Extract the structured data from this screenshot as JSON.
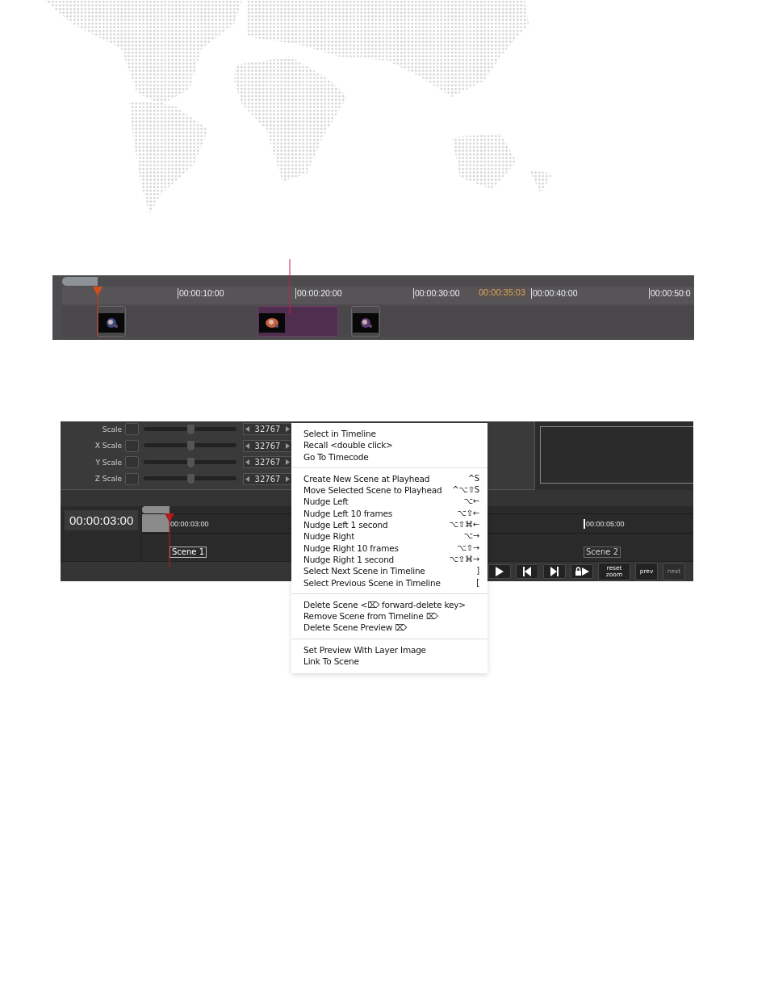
{
  "top_timeline": {
    "ticks": [
      "00:00:10:00",
      "00:00:20:00",
      "00:00:30:00",
      "00:00:40:00",
      "00:00:50:0"
    ],
    "playhead_time": "00:00:35:03",
    "clips": [
      {
        "kind": "picture",
        "selected": false
      },
      {
        "kind": "picture",
        "selected": true
      },
      {
        "kind": "picture",
        "selected": false
      }
    ]
  },
  "inspector": {
    "rows": [
      {
        "label": "Scale",
        "checked": false,
        "value": "32767",
        "level": 0.5
      },
      {
        "label": "X Scale",
        "checked": false,
        "value": "32767",
        "level": 0.5
      },
      {
        "label": "Y Scale",
        "checked": false,
        "value": "32767",
        "level": 0.5
      },
      {
        "label": "Z Scale",
        "checked": false,
        "value": "32767",
        "level": 0.5
      }
    ]
  },
  "scene_timeline": {
    "timecode": "00:00:03:00",
    "markers": [
      {
        "time": "00:00:03:00",
        "scene": "Scene 1",
        "current": true
      },
      {
        "time": "00:00:05:00",
        "scene": "Scene 2",
        "current": false
      }
    ],
    "transport": [
      {
        "kind": "play"
      },
      {
        "kind": "back"
      },
      {
        "kind": "forward"
      },
      {
        "kind": "loop"
      }
    ],
    "buttons": [
      {
        "label": "reset zoom",
        "disabled": false
      },
      {
        "label": "prev",
        "disabled": false
      },
      {
        "label": "next",
        "disabled": true
      }
    ]
  },
  "context_menu": {
    "sections": [
      [
        {
          "label": "Select in Timeline"
        },
        {
          "label": "Recall <double click>"
        },
        {
          "label": "Go To Timecode"
        }
      ],
      [
        {
          "label": "Create New Scene at Playhead",
          "shortcut": "^S"
        },
        {
          "label": "Move Selected Scene to Playhead",
          "shortcut": "^⌥⇧S"
        },
        {
          "label": "Nudge Left",
          "shortcut": "⌥←"
        },
        {
          "label": "Nudge Left 10 frames",
          "shortcut": "⌥⇧←"
        },
        {
          "label": "Nudge Left 1 second",
          "shortcut": "⌥⇧⌘←"
        },
        {
          "label": "Nudge Right",
          "shortcut": "⌥→"
        },
        {
          "label": "Nudge Right 10 frames",
          "shortcut": "⌥⇧→"
        },
        {
          "label": "Nudge Right 1 second",
          "shortcut": "⌥⇧⌘→"
        },
        {
          "label": "Select Next Scene in Timeline",
          "shortcut": "]"
        },
        {
          "label": "Select Previous Scene in Timeline",
          "shortcut": "["
        }
      ],
      [
        {
          "label": "Delete Scene <⌦ forward-delete key>"
        },
        {
          "label": "Remove Scene from Timeline ⌦"
        },
        {
          "label": "Delete Scene Preview ⌦"
        }
      ],
      [
        {
          "label": "Set Preview With Layer Image"
        },
        {
          "label": "Link To Scene"
        }
      ]
    ]
  }
}
